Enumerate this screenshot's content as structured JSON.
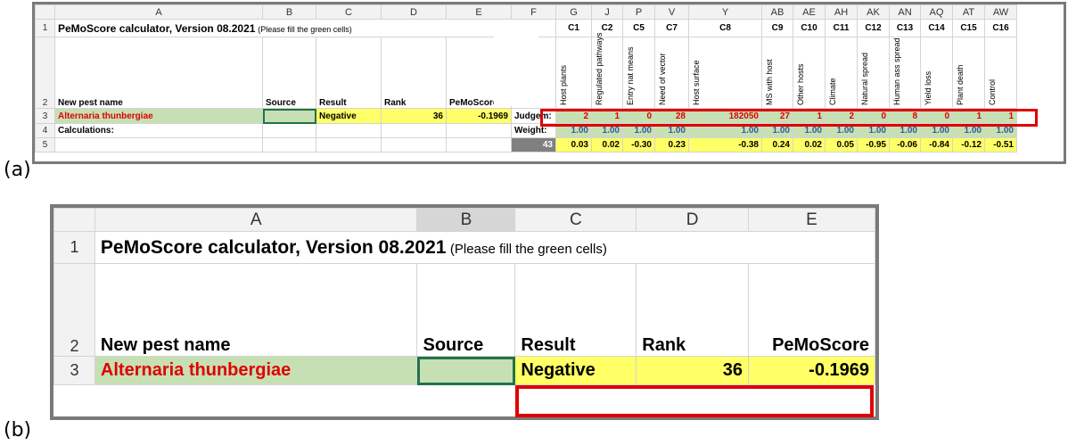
{
  "labels": {
    "a": "(a)",
    "b": "(b)"
  },
  "sheet_a": {
    "col_headers": [
      "A",
      "B",
      "C",
      "D",
      "E",
      "F",
      "G",
      "J",
      "P",
      "V",
      "Y",
      "AB",
      "AE",
      "AH",
      "AK",
      "AN",
      "AQ",
      "AT",
      "AW"
    ],
    "row_numbers": [
      "1",
      "2",
      "3",
      "4",
      "5"
    ],
    "title": "PeMoScore calculator, Version 08.2021",
    "title_note": "(Please fill the green cells)",
    "criteria_codes": [
      "C1",
      "C2",
      "C5",
      "C7",
      "C8",
      "C9",
      "C10",
      "C11",
      "C12",
      "C13",
      "C14",
      "C15",
      "C16"
    ],
    "criteria_names": [
      "Host plants",
      "Regulated pathways",
      "Entry nat means",
      "Need of vector",
      "Host surface",
      "MS with host",
      "Other hosts",
      "Climate",
      "Natural spread",
      "Human ass spread",
      "Yield loss",
      "Plant death",
      "Control"
    ],
    "row2": {
      "pest_label": "New pest name",
      "source": "Source",
      "result": "Result",
      "rank": "Rank",
      "score": "PeMoScore"
    },
    "row3": {
      "pest": "Alternaria thunbergiae",
      "result": "Negative",
      "rank": "36",
      "score": "-0.1969",
      "judge_label": "Judgem:",
      "judgements": [
        "2",
        "1",
        "0",
        "28",
        "182050",
        "27",
        "1",
        "2",
        "0",
        "8",
        "0",
        "1",
        "1"
      ]
    },
    "row4": {
      "calc_label": "Calculations:",
      "weight_label": "Weight:",
      "weights": [
        "1.00",
        "1.00",
        "1.00",
        "1.00",
        "1.00",
        "1.00",
        "1.00",
        "1.00",
        "1.00",
        "1.00",
        "1.00",
        "1.00",
        "1.00"
      ]
    },
    "row5": {
      "count": "43",
      "values": [
        "0.03",
        "0.02",
        "-0.30",
        "0.23",
        "-0.38",
        "0.24",
        "0.02",
        "0.05",
        "-0.95",
        "-0.06",
        "-0.84",
        "-0.12",
        "-0.51"
      ]
    }
  },
  "sheet_b": {
    "col_headers": [
      "A",
      "B",
      "C",
      "D",
      "E"
    ],
    "row_numbers": [
      "1",
      "2",
      "3"
    ],
    "title": "PeMoScore calculator, Version 08.2021",
    "title_note": "(Please fill the green cells)",
    "row2": {
      "pest_label": "New pest name",
      "source": "Source",
      "result": "Result",
      "rank": "Rank",
      "score": "PeMoScore"
    },
    "row3": {
      "pest": "Alternaria thunbergiae",
      "result": "Negative",
      "rank": "36",
      "score": "-0.1969"
    }
  },
  "colors": {
    "highlight": "#e00000",
    "input_green": "#c6e0b4",
    "output_yellow": "#ffff66",
    "selection": "#217346"
  }
}
